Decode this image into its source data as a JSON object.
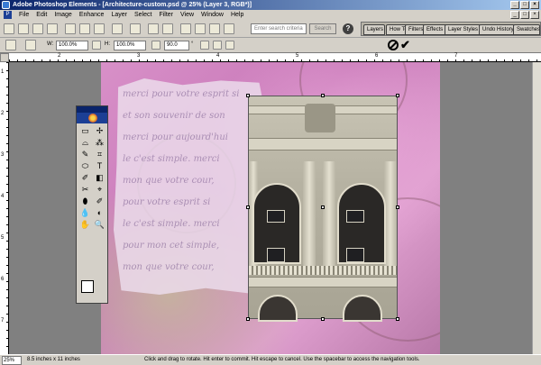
{
  "window": {
    "title": "Adobe Photoshop Elements - [Architecture-custom.psd @ 25% (Layer 3, RGB*)]",
    "minimize": "_",
    "maximize": "□",
    "close": "×"
  },
  "menu": {
    "items": [
      "File",
      "Edit",
      "Image",
      "Enhance",
      "Layer",
      "Select",
      "Filter",
      "View",
      "Window",
      "Help"
    ]
  },
  "toolbar": {
    "search_placeholder": "Enter search criteria",
    "search_button": "Search",
    "help_icon": "?"
  },
  "palette_well": {
    "tabs": [
      "Layers",
      "How To",
      "Filters",
      "Effects",
      "Layer Styles",
      "Undo History",
      "Swatches"
    ]
  },
  "options": {
    "width_label": "W:",
    "width_value": "100.0%",
    "height_label": "H:",
    "height_value": "100.0%",
    "angle_value": "90.0",
    "angle_unit": "°"
  },
  "toolbox": {
    "tools": [
      "▭",
      "✢",
      "⌓",
      "⁂",
      "✎",
      "⌗",
      "⬭",
      "T",
      "✐",
      "◧",
      "✂",
      "⌖",
      "⬮",
      "✐",
      "💧",
      "◐",
      "✋",
      "🔍"
    ]
  },
  "canvas": {
    "script_lines": [
      "merci pour votre esprit si",
      "et son souvenir de son",
      "merci pour aujourd'hui",
      "le c'est simple. merci",
      "mon que votre cour,",
      "pour votre esprit si",
      "le c'est simple. merci",
      "pour mon cet simple,",
      "mon que votre cour,"
    ]
  },
  "ruler": {
    "top_labels": [
      "2",
      "3",
      "4",
      "5",
      "6",
      "7"
    ],
    "left_labels": [
      "1",
      "2",
      "3",
      "4",
      "5",
      "6",
      "7"
    ]
  },
  "status": {
    "zoom": "25%",
    "doc_size": "8.5 inches x 11 inches",
    "hint": "Click and drag to rotate. Hit enter to commit. Hit escape to cancel. Use the spacebar to access the navigation tools."
  },
  "colors": {
    "titlebar": "#0a246a",
    "canvas_pink": "#d890c8",
    "chrome": "#d4d0c8"
  }
}
